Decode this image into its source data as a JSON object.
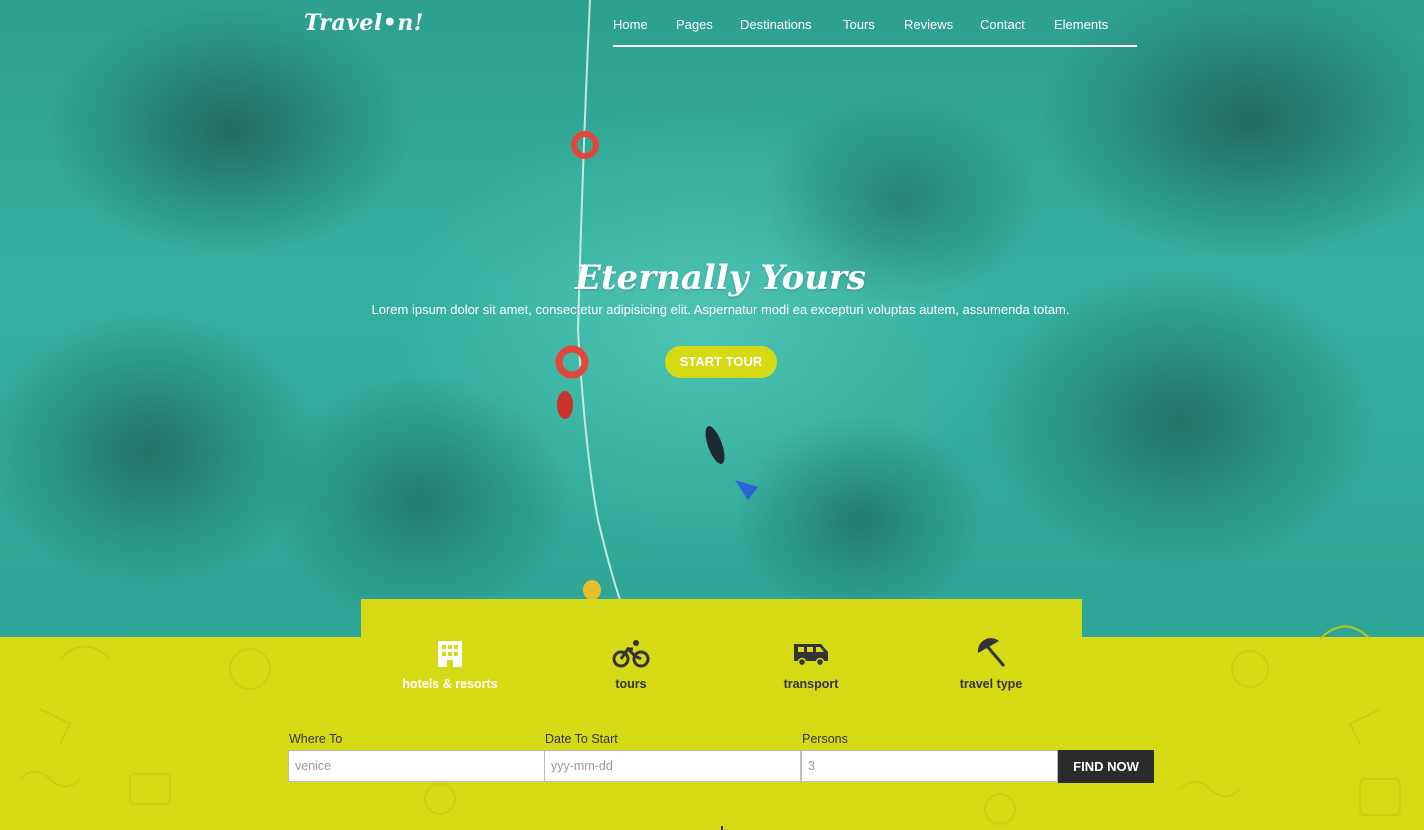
{
  "brand": {
    "logo_text": "Travel•n!"
  },
  "nav": {
    "items": [
      {
        "label": "Home"
      },
      {
        "label": "Pages"
      },
      {
        "label": "Destinations"
      },
      {
        "label": "Tours"
      },
      {
        "label": "Reviews"
      },
      {
        "label": "Contact"
      },
      {
        "label": "Elements"
      }
    ]
  },
  "hero": {
    "title": "Eternally Yours",
    "subtitle": "Lorem ipsum dolor sit amet, consectetur adipisicing elit. Aspernatur modi ea excepturi voluptas autem, assumenda totam.",
    "cta_label": "START TOUR"
  },
  "search": {
    "tabs": [
      {
        "label": "hotels & resorts",
        "icon": "building-icon",
        "active": true
      },
      {
        "label": "tours",
        "icon": "bicycle-icon",
        "active": false
      },
      {
        "label": "transport",
        "icon": "van-icon",
        "active": false
      },
      {
        "label": "travel type",
        "icon": "beach-umbrella-icon",
        "active": false
      }
    ],
    "where_label": "Where To",
    "where_placeholder": "venice",
    "date_label": "Date To Start",
    "date_placeholder": "yyy-mm-dd",
    "persons_label": "Persons",
    "persons_placeholder": "3",
    "submit_label": "FIND NOW"
  },
  "colors": {
    "accent": "#d6da15",
    "dark": "#2b2b2b",
    "water": "#34b0a0"
  }
}
